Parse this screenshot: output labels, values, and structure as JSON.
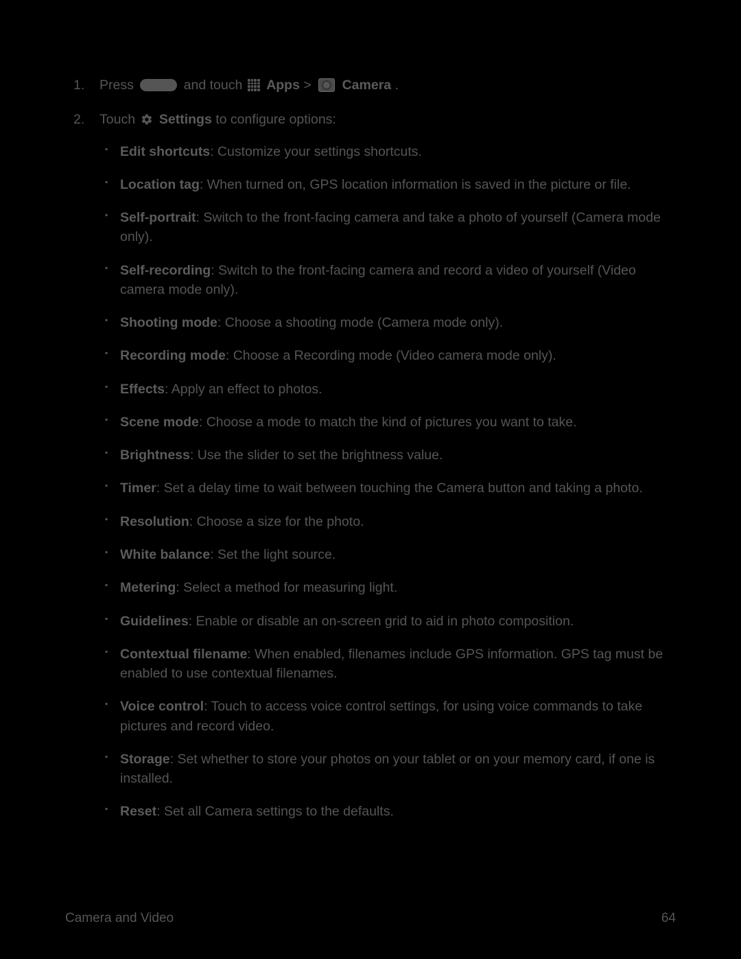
{
  "step1": {
    "t1": "Press ",
    "t2": " and touch ",
    "apps": "Apps",
    "gt": " > ",
    "camera": "Camera",
    "end": "."
  },
  "step2": {
    "t1": "Touch ",
    "settings": "Settings",
    "t2": " to configure options:"
  },
  "bullets": [
    {
      "b": "Edit shortcuts",
      "t": ": Customize your settings shortcuts."
    },
    {
      "b": "Location tag",
      "t": ": When turned on, GPS location information is saved in the picture or file."
    },
    {
      "b": "Self-portrait",
      "t": ": Switch to the front-facing camera and take a photo of yourself (Camera mode only)."
    },
    {
      "b": "Self-recording",
      "t": ": Switch to the front-facing camera and record a video of yourself (Video camera mode only)."
    },
    {
      "b": "Shooting mode",
      "t": ": Choose a shooting mode (Camera mode only)."
    },
    {
      "b": "Recording mode",
      "t": ": Choose a Recording mode (Video camera mode only)."
    },
    {
      "b": "Effects",
      "t": ": Apply an effect to photos."
    },
    {
      "b": "Scene mode",
      "t": ": Choose a mode to match the kind of pictures you want to take."
    },
    {
      "b": "Brightness",
      "t": ": Use the slider to set the brightness value."
    },
    {
      "b": "Timer",
      "t": ": Set a delay time to wait between touching the Camera button and taking a photo."
    },
    {
      "b": "Resolution",
      "t": ": Choose a size for the photo."
    },
    {
      "b": "White balance",
      "t": ": Set the light source."
    },
    {
      "b": "Metering",
      "t": ": Select a method for measuring light."
    },
    {
      "b": "Guidelines",
      "t": ": Enable or disable an on-screen grid to aid in photo composition."
    },
    {
      "b": "Contextual filename",
      "t": ": When enabled, filenames include GPS information. GPS tag must be enabled to use contextual filenames."
    },
    {
      "b": "Voice control",
      "t": ": Touch to access voice control settings, for using voice commands to take pictures and record video."
    },
    {
      "b": "Storage",
      "t": ": Set whether to store your photos on your tablet or on your memory card, if one is installed."
    },
    {
      "b": "Reset",
      "t": ": Set all Camera settings to the defaults."
    }
  ],
  "footer": {
    "left": "Camera and Video",
    "right": "64"
  }
}
